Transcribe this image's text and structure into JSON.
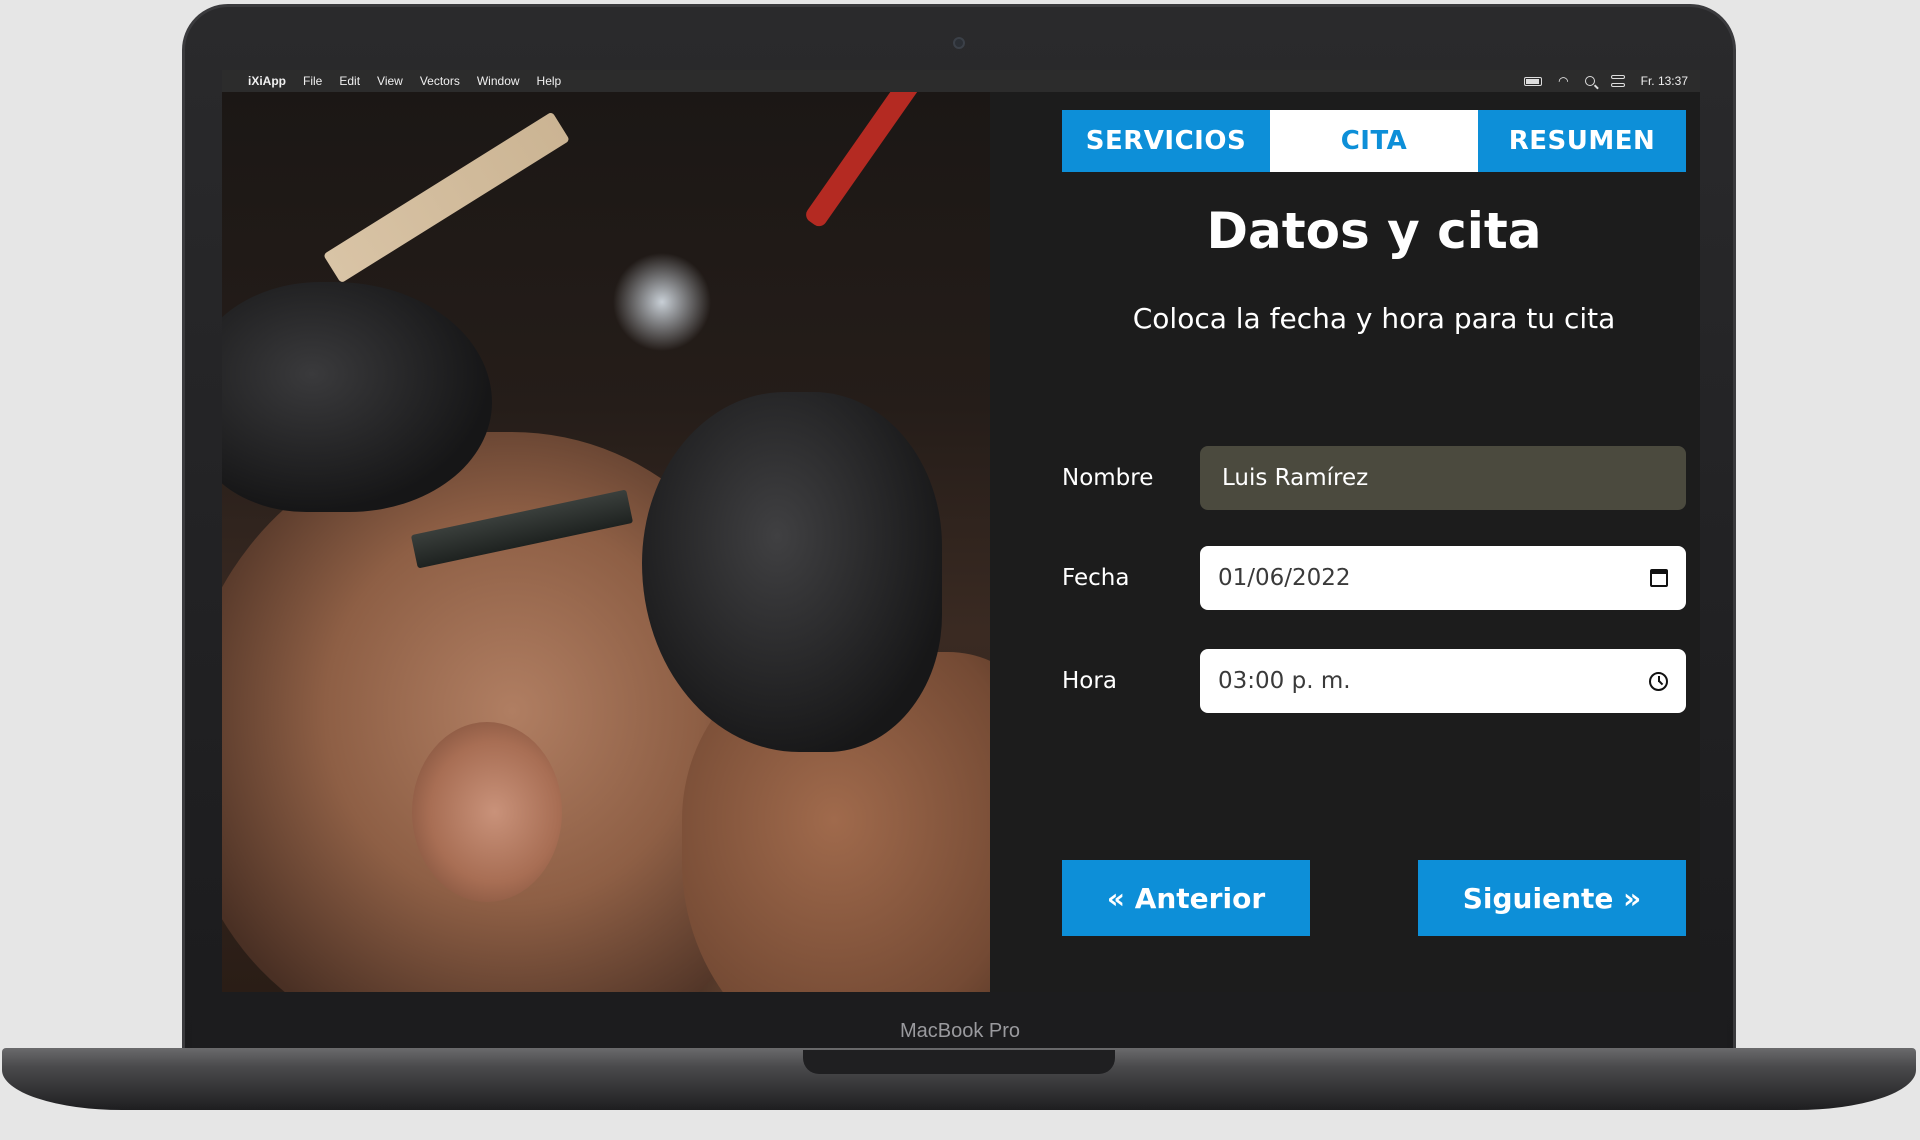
{
  "device": {
    "label": "MacBook Pro"
  },
  "menubar": {
    "apple_symbol": "",
    "items": [
      "iXiApp",
      "File",
      "Edit",
      "View",
      "Vectors",
      "Window",
      "Help"
    ],
    "clock": "Fr. 13:37",
    "status_icons": [
      "battery-icon",
      "wifi-icon",
      "search-icon",
      "control-center-icon"
    ]
  },
  "photo": {
    "subject": "barber-shaving-photo"
  },
  "app": {
    "tabs": [
      {
        "label": "SERVICIOS",
        "active": false
      },
      {
        "label": "CITA",
        "active": true
      },
      {
        "label": "RESUMEN",
        "active": false
      }
    ],
    "heading": "Datos y cita",
    "subheading": "Coloca la fecha y hora para tu cita",
    "form": {
      "nombre": {
        "label": "Nombre",
        "value": "Luis Ramírez"
      },
      "fecha": {
        "label": "Fecha",
        "value": "01/06/2022"
      },
      "hora": {
        "label": "Hora",
        "value": "03:00 p. m."
      }
    },
    "buttons": {
      "prev": "« Anterior",
      "next": "Siguiente »"
    },
    "colors": {
      "accent": "#0d8fd8",
      "panel_bg": "#1c1c1c",
      "readonly_field": "#4b4a3e"
    }
  }
}
